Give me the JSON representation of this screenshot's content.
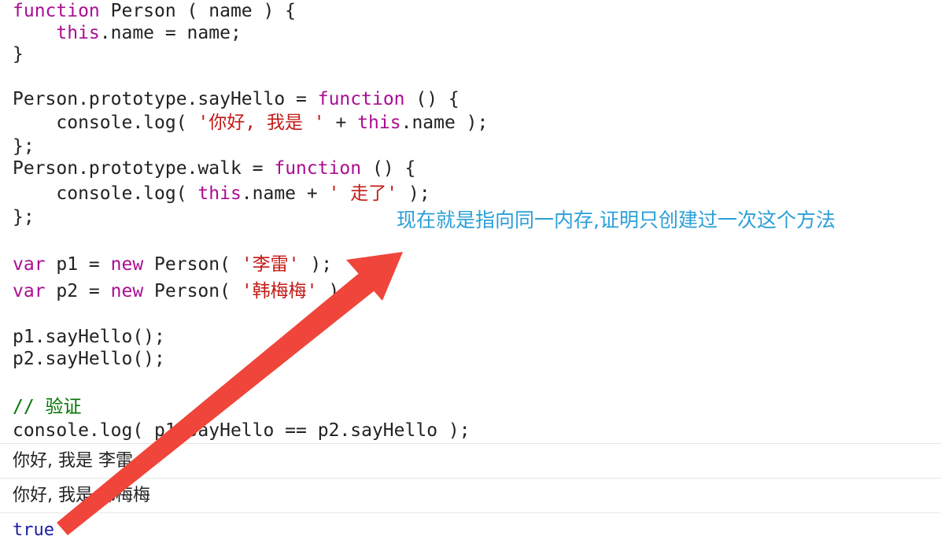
{
  "code": {
    "lines": [
      [
        {
          "t": "kw",
          "v": "function"
        },
        {
          "t": "plain",
          "v": " Person ( name ) {"
        }
      ],
      [
        {
          "t": "plain",
          "v": "    "
        },
        {
          "t": "kw",
          "v": "this"
        },
        {
          "t": "plain",
          "v": ".name = name;"
        }
      ],
      [
        {
          "t": "plain",
          "v": "}"
        }
      ],
      [
        {
          "t": "plain",
          "v": "Person.prototype.sayHello = "
        },
        {
          "t": "kw",
          "v": "function"
        },
        {
          "t": "plain",
          "v": " () {"
        }
      ],
      [
        {
          "t": "plain",
          "v": "    console.log( "
        },
        {
          "t": "str",
          "v": "'你好, 我是 '"
        },
        {
          "t": "plain",
          "v": " + "
        },
        {
          "t": "kw",
          "v": "this"
        },
        {
          "t": "plain",
          "v": ".name );"
        }
      ],
      [
        {
          "t": "plain",
          "v": "};"
        }
      ],
      [
        {
          "t": "plain",
          "v": "Person.prototype.walk = "
        },
        {
          "t": "kw",
          "v": "function"
        },
        {
          "t": "plain",
          "v": " () {"
        }
      ],
      [
        {
          "t": "plain",
          "v": "    console.log( "
        },
        {
          "t": "kw",
          "v": "this"
        },
        {
          "t": "plain",
          "v": ".name + "
        },
        {
          "t": "str",
          "v": "' 走了'"
        },
        {
          "t": "plain",
          "v": " );"
        }
      ],
      [
        {
          "t": "plain",
          "v": "};"
        }
      ],
      [
        {
          "t": "kw",
          "v": "var"
        },
        {
          "t": "plain",
          "v": " p1 = "
        },
        {
          "t": "kw",
          "v": "new"
        },
        {
          "t": "plain",
          "v": " Person( "
        },
        {
          "t": "str",
          "v": "'李雷'"
        },
        {
          "t": "plain",
          "v": " );"
        }
      ],
      [
        {
          "t": "kw",
          "v": "var"
        },
        {
          "t": "plain",
          "v": " p2 = "
        },
        {
          "t": "kw",
          "v": "new"
        },
        {
          "t": "plain",
          "v": " Person( "
        },
        {
          "t": "str",
          "v": "'韩梅梅'"
        },
        {
          "t": "plain",
          "v": " );"
        }
      ],
      [
        {
          "t": "plain",
          "v": "p1.sayHello();"
        }
      ],
      [
        {
          "t": "plain",
          "v": "p2.sayHello();"
        }
      ],
      [
        {
          "t": "cmt",
          "v": "// 验证"
        }
      ],
      [
        {
          "t": "plain",
          "v": "console.log( p1.sayHello == p2.sayHello );"
        }
      ]
    ]
  },
  "console_output": [
    {
      "kind": "log",
      "text": "你好, 我是 李雷"
    },
    {
      "kind": "log",
      "text": "你好, 我是 韩梅梅"
    },
    {
      "kind": "result",
      "text": "true"
    }
  ],
  "annotation": {
    "text": "现在就是指向同一内存,证明只创建过一次这个方法",
    "arrow_color": "#f0453a",
    "text_color": "#2b9fd8"
  },
  "colors": {
    "keyword": "#aa0d91",
    "string": "#c41a16",
    "comment": "#007400",
    "result": "#1a1aa6"
  }
}
